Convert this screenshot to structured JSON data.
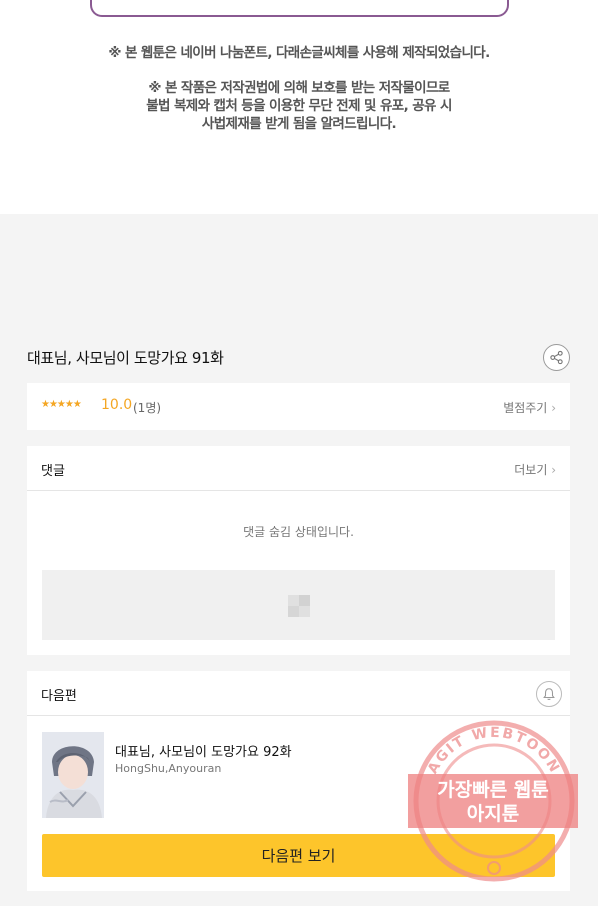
{
  "notices": {
    "font_notice": "※ 본 웹툰은 네이버 나눔폰트, 다래손글씨체를 사용해 제작되었습니다.",
    "copyright_line1": "※ 본 작품은 저작권법에 의해 보호를 받는 저작물이므로",
    "copyright_line2": "불법 복제와 캡처 등을 이용한 무단 전제 및 유포, 공유 시",
    "copyright_line3": "사법제재를 받게 됨을 알려드립니다."
  },
  "episode": {
    "title": "대표님, 사모님이 도망가요 91화"
  },
  "rating": {
    "stars": "★★★★★",
    "score": "10.0",
    "count": "(1명)",
    "rate_link": "별점주기"
  },
  "comments": {
    "label": "댓글",
    "more_link": "더보기",
    "hidden_message": "댓글 숨김 상태입니다."
  },
  "next_episode": {
    "label": "다음편",
    "title": "대표님, 사모님이 도망가요 92화",
    "authors": "HongShu,Anyouran",
    "button_label": "다음편 보기"
  },
  "watermark": {
    "arc_text": "AGIT WEBTOON",
    "line1": "가장빠른 웹툰",
    "line2": "아지툰"
  },
  "icons": {
    "share": "share-icon",
    "bell": "bell-icon",
    "chevron": "chevron-right-icon"
  },
  "colors": {
    "accent_yellow": "#fdc52b",
    "star_orange": "#f4a623",
    "watermark_red": "#e86a6a"
  }
}
